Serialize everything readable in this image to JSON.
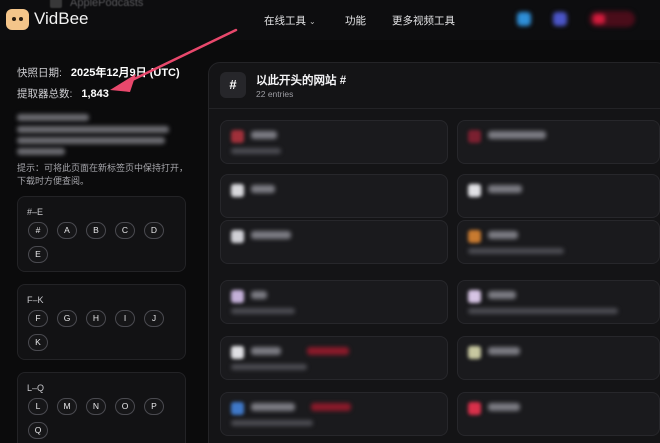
{
  "header": {
    "brand": "VidBee",
    "ghost_tab": "ApplePodcasts",
    "nav": [
      "在线工具",
      "功能",
      "更多视频工具"
    ]
  },
  "sidebar": {
    "snapshot_label": "快照日期:",
    "snapshot_value": "2025年12月9日 (UTC)",
    "total_label": "提取器总数:",
    "total_value": "1,843",
    "tip": "提示：可将此页面在新标签页中保持打开，下载时方便查阅。",
    "groups": [
      {
        "title": "#–E",
        "chips": [
          "#",
          "A",
          "B",
          "C",
          "D",
          "E"
        ]
      },
      {
        "title": "F–K",
        "chips": [
          "F",
          "G",
          "H",
          "I",
          "J",
          "K"
        ]
      },
      {
        "title": "L–Q",
        "chips": [
          "L",
          "M",
          "N",
          "O",
          "P",
          "Q"
        ]
      }
    ]
  },
  "main": {
    "badge": "#",
    "title": "以此开头的网站 #",
    "subtitle": "22 entries"
  },
  "colors": {
    "background": "#0b0b0c",
    "panel": "#141416",
    "accent_arrow": "#e8486c",
    "brand_logo": "#f4c58a"
  }
}
